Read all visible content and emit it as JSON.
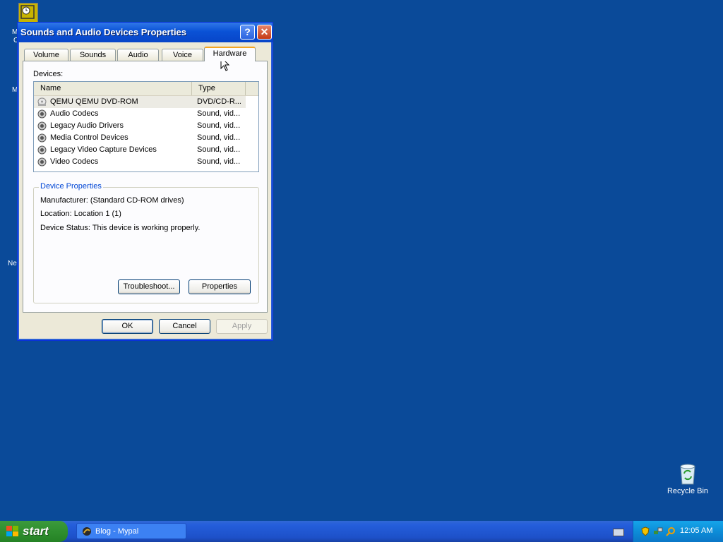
{
  "desktop": {
    "fragments": [
      "M",
      "C",
      "M",
      "Ne"
    ],
    "recycle_bin_label": "Recycle Bin"
  },
  "dialog": {
    "title": "Sounds and Audio Devices Properties",
    "help_label": "?",
    "close_label": "✕",
    "tabs": [
      {
        "label": "Volume"
      },
      {
        "label": "Sounds"
      },
      {
        "label": "Audio"
      },
      {
        "label": "Voice"
      },
      {
        "label": "Hardware"
      }
    ],
    "active_tab": "Hardware",
    "devices_label": "Devices:",
    "columns": [
      "Name",
      "Type"
    ],
    "devices": [
      {
        "name": "QEMU QEMU DVD-ROM",
        "type": "DVD/CD-R...",
        "icon": "dvd-drive-icon",
        "selected": true
      },
      {
        "name": "Audio Codecs",
        "type": "Sound, vid...",
        "icon": "speaker-icon"
      },
      {
        "name": "Legacy Audio Drivers",
        "type": "Sound, vid...",
        "icon": "speaker-icon"
      },
      {
        "name": "Media Control Devices",
        "type": "Sound, vid...",
        "icon": "speaker-icon"
      },
      {
        "name": "Legacy Video Capture Devices",
        "type": "Sound, vid...",
        "icon": "speaker-icon"
      },
      {
        "name": "Video Codecs",
        "type": "Sound, vid...",
        "icon": "speaker-icon"
      }
    ],
    "device_properties": {
      "title": "Device Properties",
      "manufacturer": "Manufacturer: (Standard CD-ROM drives)",
      "location": "Location: Location 1 (1)",
      "status": "Device Status: This device is working properly."
    },
    "troubleshoot_label": "Troubleshoot...",
    "properties_label": "Properties",
    "ok_label": "OK",
    "cancel_label": "Cancel",
    "apply_label": "Apply"
  },
  "taskbar": {
    "start_label": "start",
    "task_label": "Blog - Mypal",
    "clock": "12:05 AM"
  },
  "colors": {
    "desktop": "#0a4a99",
    "titlebar": "#0a52d6",
    "taskbar": "#245edb",
    "start": "#2f8f2f",
    "tray": "#0d8dd8",
    "active_tab_accent": "#f5a623"
  }
}
